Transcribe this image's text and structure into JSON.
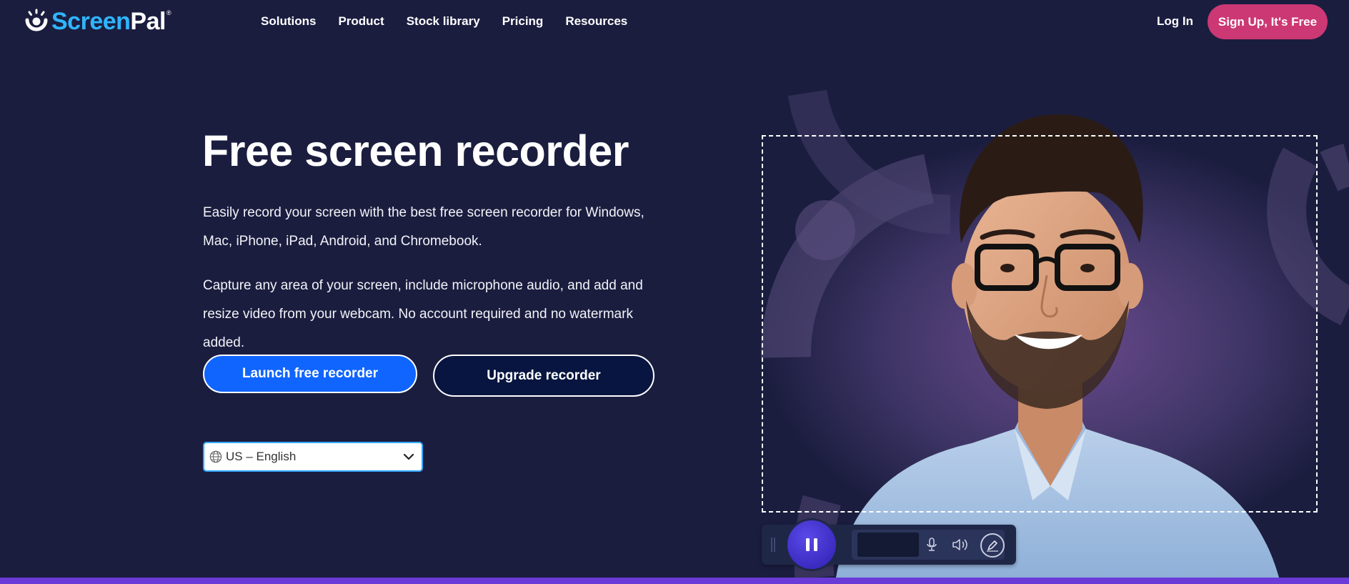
{
  "brand": {
    "name_part1": "Screen",
    "name_part2": "Pal",
    "registered": "®",
    "logo_icon": "screenpal-logo-icon",
    "accent": "#2fb5ff"
  },
  "nav": {
    "links": [
      "Solutions",
      "Product",
      "Stock library",
      "Pricing",
      "Resources"
    ],
    "login": "Log In",
    "signup": "Sign Up, It's Free"
  },
  "hero": {
    "title": "Free screen recorder",
    "paragraph1": "Easily record your screen with the best free screen recorder for Windows, Mac, iPhone, iPad, Android, and Chromebook.",
    "paragraph2": "Capture any area of your screen, include microphone audio, and add and resize video from your webcam. No account required and no watermark added.",
    "launch_button": "Launch free recorder",
    "upgrade_button": "Upgrade recorder"
  },
  "language_select": {
    "selected": "US – English",
    "icon": "globe-icon"
  },
  "recorder_toolbar": {
    "icons": [
      "drag-handle-icon",
      "pause-icon",
      "microphone-icon",
      "volume-icon",
      "pen-icon"
    ]
  },
  "colors": {
    "background": "#1b1d3f",
    "signup_button": "#cc3874",
    "launch_button": "#1065fe",
    "upgrade_button": "#071540",
    "bottom_bar": "#6a3bd6"
  }
}
